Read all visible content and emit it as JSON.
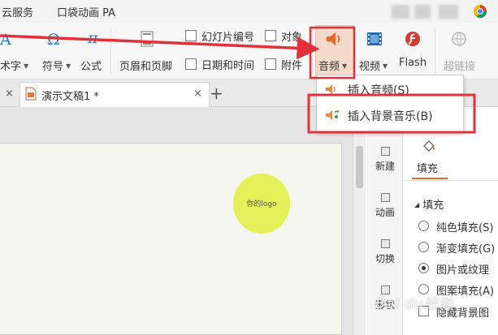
{
  "menu": {
    "item_cloud": "云服务",
    "item_pa": "口袋动画 PA"
  },
  "ribbon": {
    "art_text": "术字",
    "symbol": "符号",
    "formula": "公式",
    "header_footer": "页眉和页脚",
    "slide_number": "幻灯片编号",
    "object": "对象",
    "date_time": "日期和时间",
    "attachment": "附件",
    "audio": "音频",
    "video": "视频",
    "flash": "Flash",
    "hyperlink": "超链接",
    "glyph_omega": "Ω",
    "glyph_pi": "π",
    "glyph_a": "A"
  },
  "tabs": {
    "doc_title": "演示文稿1 *",
    "close": "×",
    "new_tab": "+"
  },
  "audio_menu": {
    "insert_audio": "插入音频(S)",
    "insert_bg_music": "插入背景音乐(B)"
  },
  "slide": {
    "logo_text": "你的logo"
  },
  "side_panel": {
    "new": "新建",
    "animation": "动画",
    "switch": "切换",
    "shape": "形状",
    "fill_tab": "填充",
    "fill_section": "填充",
    "solid_fill": "纯色填充(S)",
    "gradient_fill": "渐变填充(G)",
    "picture_fill": "图片或纹理",
    "pattern_fill": "图案填充(A)",
    "hide_background": "隐藏背景图",
    "watermark": "Bai du经验"
  },
  "colors": {
    "highlight_red": "#e1323c",
    "accent_orange": "#e06a2b",
    "logo_yellow": "#e3f05a",
    "audio_highlight": "#f5d9c9"
  }
}
